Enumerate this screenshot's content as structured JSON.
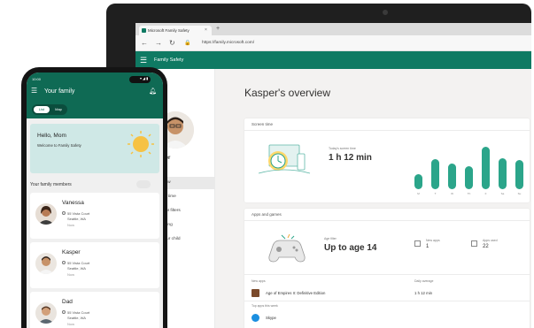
{
  "browser": {
    "tab_title": "Microsoft Family Safety",
    "tab_close": "×",
    "new_tab": "+",
    "url": "https://family.microsoft.com/"
  },
  "app": {
    "title": "Family Safety",
    "brand_color": "#0f7a63"
  },
  "sidebar": {
    "profile_name": "per",
    "items": [
      {
        "label": "view",
        "active": true
      },
      {
        "label": "en time",
        "active": false
      },
      {
        "label": "tent filters",
        "active": false
      },
      {
        "label": "nding",
        "active": false
      },
      {
        "label": "your child",
        "active": false
      }
    ]
  },
  "overview": {
    "title": "Kasper's overview",
    "screen_time": {
      "title": "Screen time",
      "today_label": "Today's screen time",
      "value": "1 h 12 min",
      "days": [
        "M",
        "T",
        "W",
        "Th",
        "F",
        "Sa",
        "Su"
      ],
      "bar_levels": [
        0.35,
        0.7,
        0.6,
        0.55,
        1.0,
        0.72,
        0.68
      ],
      "bar_color": "#2ba58a"
    },
    "apps_games": {
      "title": "Apps and games",
      "age_filter_label": "Age filter",
      "age_filter_value": "Up to age 14",
      "stats": [
        {
          "label": "New apps",
          "value": "1"
        },
        {
          "label": "Apps used",
          "value": "22"
        }
      ],
      "table_headers": [
        "New apps",
        "Daily average"
      ],
      "rows": [
        {
          "name": "Age of Empires II: Definitive Edition",
          "time": "1 h 12 min"
        }
      ],
      "top_apps_label": "Top apps this week",
      "top_app_name": "Skype"
    }
  },
  "phone": {
    "time": "10:00",
    "status": "▾◢▮",
    "header_title": "Your family",
    "toggle": {
      "list": "List",
      "map": "Map"
    },
    "hello_title": "Hello, Mom",
    "hello_subtitle": "Welcome to Family Safety",
    "members_heading": "Your family members",
    "members": [
      {
        "name": "Vanessa",
        "street": "55 Vista Court",
        "city": "Seattle, WA",
        "when": "Now"
      },
      {
        "name": "Kasper",
        "street": "55 Vista Court",
        "city": "Seattle, WA",
        "when": "Now"
      },
      {
        "name": "Dad",
        "street": "55 Vista Court",
        "city": "Seattle, WA",
        "when": "Now"
      }
    ]
  }
}
